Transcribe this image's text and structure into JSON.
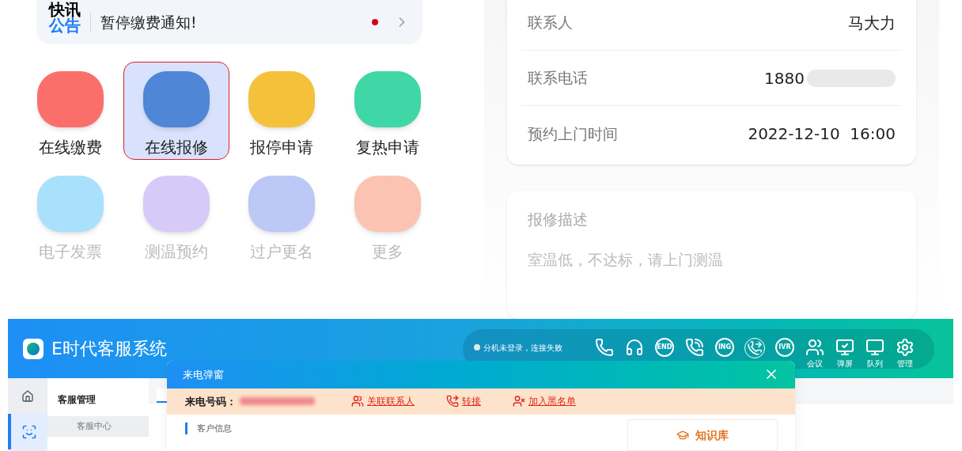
{
  "notice": {
    "logo_top": "快讯",
    "logo_bottom": "公告",
    "text": "暂停缴费通知!",
    "unread": true
  },
  "services": [
    {
      "label": "在线缴费",
      "selected": false,
      "color": "#fb6f6b"
    },
    {
      "label": "在线报修",
      "selected": true,
      "color": "#4f86d6"
    },
    {
      "label": "报停申请",
      "selected": false,
      "color": "#f5c13a"
    },
    {
      "label": "复热申请",
      "selected": false,
      "color": "#3fd7a6"
    },
    {
      "label": "电子发票",
      "selected": false,
      "color": "#a9e0fc"
    },
    {
      "label": "测温预约",
      "selected": false,
      "color": "#d6cbf8"
    },
    {
      "label": "过户更名",
      "selected": false,
      "color": "#bcc8f5"
    },
    {
      "label": "更多",
      "selected": false,
      "color": "#fcc3b3"
    }
  ],
  "contact_card": [
    {
      "label": "联系人",
      "value": "马大力",
      "masked": false
    },
    {
      "label": "联系电话",
      "value": "1880",
      "masked": true
    },
    {
      "label": "预约上门时间",
      "value": "2022-12-10  16:00",
      "masked": false
    }
  ],
  "description_card": {
    "title": "报修描述",
    "text": "室温低，不达标，请上门测温"
  },
  "web_app": {
    "title": "E时代客服系统",
    "status": "分机未登录，连接失败",
    "toolbar": [
      {
        "kind": "phone"
      },
      {
        "kind": "headset"
      },
      {
        "kind": "badge",
        "badge": "END"
      },
      {
        "kind": "ring"
      },
      {
        "kind": "badge",
        "badge": "ING"
      },
      {
        "kind": "transfer"
      },
      {
        "kind": "badge",
        "badge": "IVR"
      },
      {
        "kind": "people",
        "label": "会议"
      },
      {
        "kind": "popup",
        "label": "弹屏"
      },
      {
        "kind": "queue",
        "label": "队列"
      },
      {
        "kind": "gear",
        "label": "管理"
      }
    ],
    "sidebar": [
      {
        "kind": "home",
        "selected": false
      },
      {
        "kind": "agent",
        "selected": true
      }
    ],
    "menu_title": "客服管理",
    "menu_items": [
      {
        "label": "客服中心",
        "selected": true
      }
    ]
  },
  "call_popup": {
    "title": "来电弹窗",
    "number_label": "来电号码：",
    "actions": [
      {
        "kind": "contacts",
        "label": "关联联系人"
      },
      {
        "kind": "transfer",
        "label": "转接"
      },
      {
        "kind": "block",
        "label": "加入黑名单"
      }
    ],
    "section": "客户信息",
    "knowledge": "知识库"
  }
}
